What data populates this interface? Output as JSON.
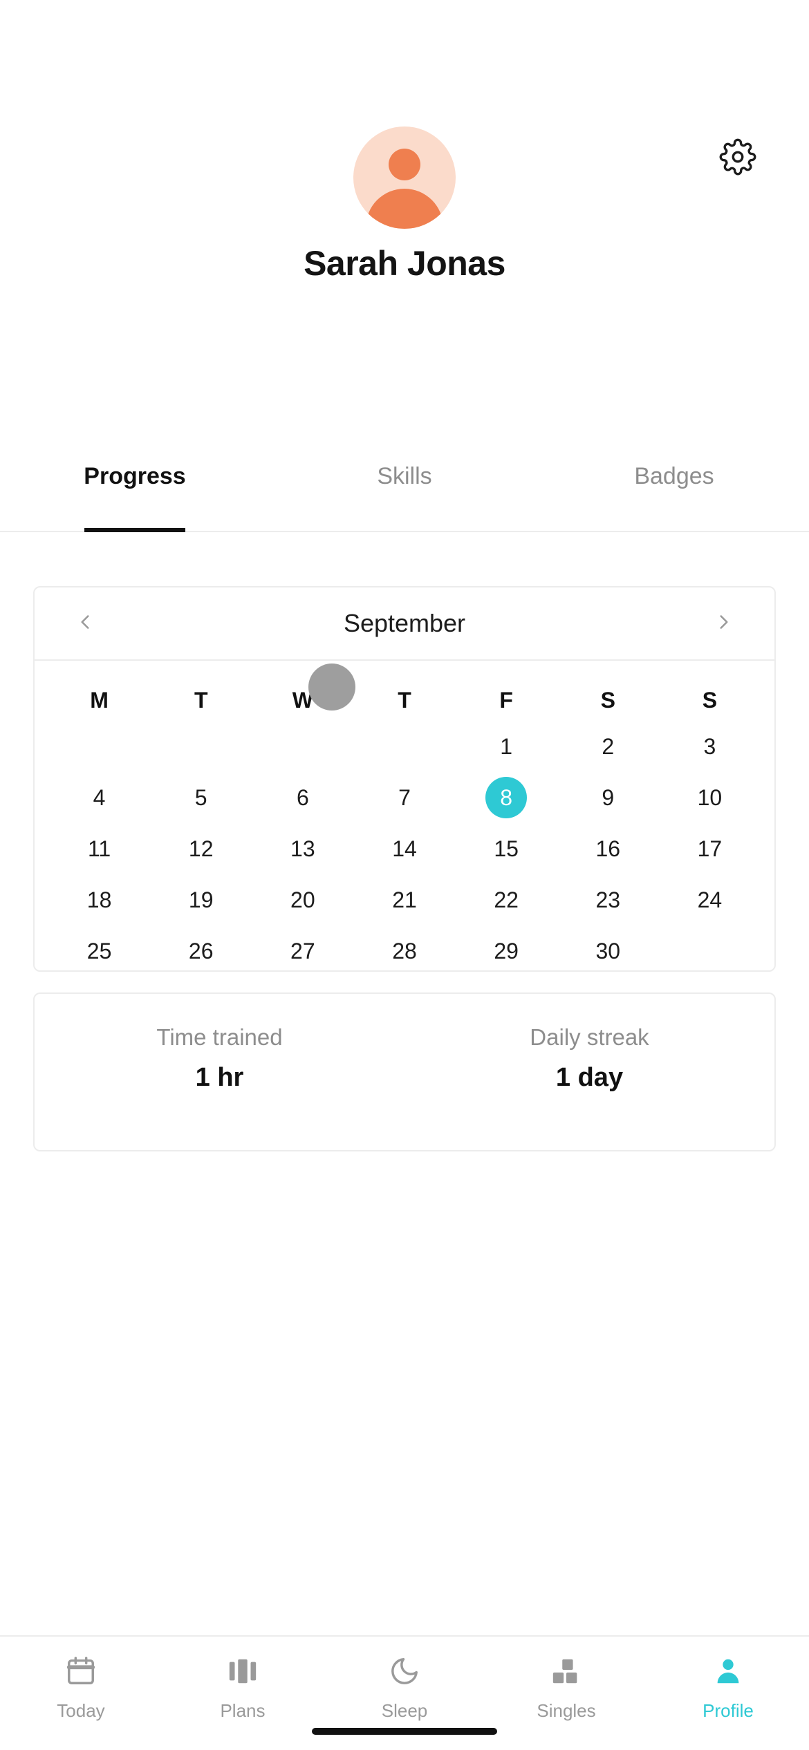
{
  "header": {
    "settings_icon": "gear-icon",
    "avatar_icon": "person-avatar",
    "profile_name": "Sarah Jonas",
    "avatar_bg": "#fbdbcb",
    "avatar_fg": "#ef7f4f"
  },
  "tabs": [
    {
      "label": "Progress",
      "active": true
    },
    {
      "label": "Skills",
      "active": false
    },
    {
      "label": "Badges",
      "active": false
    }
  ],
  "calendar": {
    "prev_icon": "chevron-left-icon",
    "next_icon": "chevron-right-icon",
    "month": "September",
    "day_initials": [
      "M",
      "T",
      "W",
      "T",
      "F",
      "S",
      "S"
    ],
    "weeks": [
      [
        "",
        "",
        "",
        "",
        "1",
        "2",
        "3"
      ],
      [
        "4",
        "5",
        "6",
        "7",
        "8",
        "9",
        "10"
      ],
      [
        "11",
        "12",
        "13",
        "14",
        "15",
        "16",
        "17"
      ],
      [
        "18",
        "19",
        "20",
        "21",
        "22",
        "23",
        "24"
      ],
      [
        "25",
        "26",
        "27",
        "28",
        "29",
        "30",
        ""
      ]
    ],
    "selected_day": "8",
    "selected_color": "#2ec9d4"
  },
  "stats": [
    {
      "label": "Time trained",
      "value": "1 hr"
    },
    {
      "label": "Daily streak",
      "value": "1 day"
    }
  ],
  "bottom_nav": [
    {
      "label": "Today",
      "icon": "calendar-icon",
      "active": false
    },
    {
      "label": "Plans",
      "icon": "columns-icon",
      "active": false
    },
    {
      "label": "Sleep",
      "icon": "moon-icon",
      "active": false
    },
    {
      "label": "Singles",
      "icon": "blocks-icon",
      "active": false
    },
    {
      "label": "Profile",
      "icon": "person-icon",
      "active": true
    }
  ],
  "accent_color": "#2ec9d4"
}
